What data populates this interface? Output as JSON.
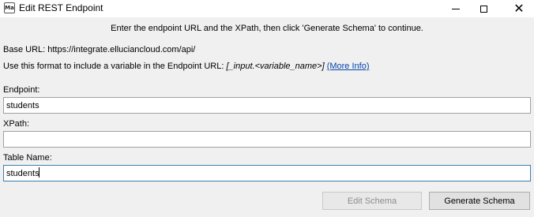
{
  "window": {
    "app_icon_text": "Ma",
    "title": "Edit REST Endpoint"
  },
  "instruction": "Enter the endpoint URL and the XPath, then click 'Generate Schema' to continue.",
  "base_url": "Base URL: https://integrate.elluciancloud.com/api/",
  "format_hint": {
    "prefix": "Use this format to include a variable in the Endpoint URL: ",
    "variable_format": "[_input.<variable_name>]",
    "more_info": "(More Info)"
  },
  "fields": {
    "endpoint": {
      "label": "Endpoint:",
      "value": "students"
    },
    "xpath": {
      "label": "XPath:",
      "value": ""
    },
    "table_name": {
      "label": "Table Name:",
      "value": "students"
    }
  },
  "buttons": {
    "edit_schema": "Edit Schema",
    "generate_schema": "Generate Schema"
  }
}
